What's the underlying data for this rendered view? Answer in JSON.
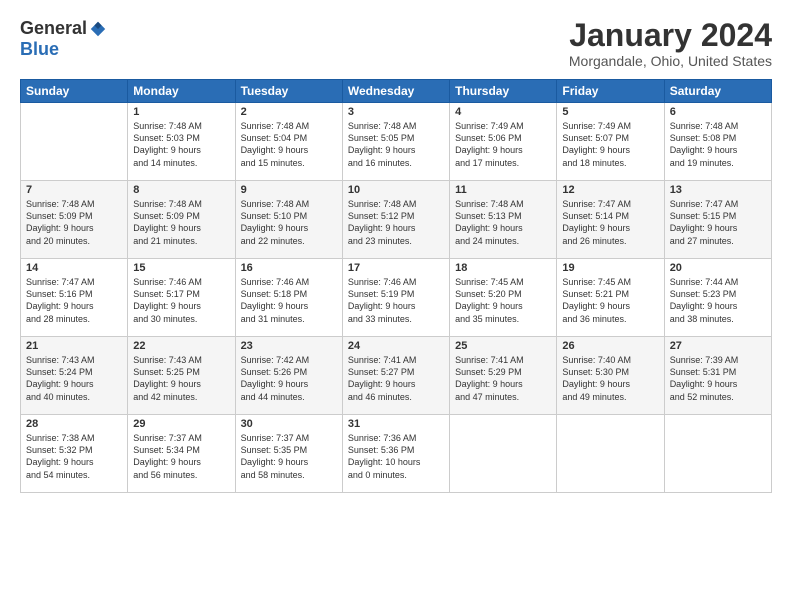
{
  "header": {
    "logo_general": "General",
    "logo_blue": "Blue",
    "title": "January 2024",
    "location": "Morgandale, Ohio, United States"
  },
  "days_of_week": [
    "Sunday",
    "Monday",
    "Tuesday",
    "Wednesday",
    "Thursday",
    "Friday",
    "Saturday"
  ],
  "weeks": [
    [
      {
        "day": "",
        "content": ""
      },
      {
        "day": "1",
        "content": "Sunrise: 7:48 AM\nSunset: 5:03 PM\nDaylight: 9 hours\nand 14 minutes."
      },
      {
        "day": "2",
        "content": "Sunrise: 7:48 AM\nSunset: 5:04 PM\nDaylight: 9 hours\nand 15 minutes."
      },
      {
        "day": "3",
        "content": "Sunrise: 7:48 AM\nSunset: 5:05 PM\nDaylight: 9 hours\nand 16 minutes."
      },
      {
        "day": "4",
        "content": "Sunrise: 7:49 AM\nSunset: 5:06 PM\nDaylight: 9 hours\nand 17 minutes."
      },
      {
        "day": "5",
        "content": "Sunrise: 7:49 AM\nSunset: 5:07 PM\nDaylight: 9 hours\nand 18 minutes."
      },
      {
        "day": "6",
        "content": "Sunrise: 7:48 AM\nSunset: 5:08 PM\nDaylight: 9 hours\nand 19 minutes."
      }
    ],
    [
      {
        "day": "7",
        "content": "Sunrise: 7:48 AM\nSunset: 5:09 PM\nDaylight: 9 hours\nand 20 minutes."
      },
      {
        "day": "8",
        "content": "Sunrise: 7:48 AM\nSunset: 5:09 PM\nDaylight: 9 hours\nand 21 minutes."
      },
      {
        "day": "9",
        "content": "Sunrise: 7:48 AM\nSunset: 5:10 PM\nDaylight: 9 hours\nand 22 minutes."
      },
      {
        "day": "10",
        "content": "Sunrise: 7:48 AM\nSunset: 5:12 PM\nDaylight: 9 hours\nand 23 minutes."
      },
      {
        "day": "11",
        "content": "Sunrise: 7:48 AM\nSunset: 5:13 PM\nDaylight: 9 hours\nand 24 minutes."
      },
      {
        "day": "12",
        "content": "Sunrise: 7:47 AM\nSunset: 5:14 PM\nDaylight: 9 hours\nand 26 minutes."
      },
      {
        "day": "13",
        "content": "Sunrise: 7:47 AM\nSunset: 5:15 PM\nDaylight: 9 hours\nand 27 minutes."
      }
    ],
    [
      {
        "day": "14",
        "content": "Sunrise: 7:47 AM\nSunset: 5:16 PM\nDaylight: 9 hours\nand 28 minutes."
      },
      {
        "day": "15",
        "content": "Sunrise: 7:46 AM\nSunset: 5:17 PM\nDaylight: 9 hours\nand 30 minutes."
      },
      {
        "day": "16",
        "content": "Sunrise: 7:46 AM\nSunset: 5:18 PM\nDaylight: 9 hours\nand 31 minutes."
      },
      {
        "day": "17",
        "content": "Sunrise: 7:46 AM\nSunset: 5:19 PM\nDaylight: 9 hours\nand 33 minutes."
      },
      {
        "day": "18",
        "content": "Sunrise: 7:45 AM\nSunset: 5:20 PM\nDaylight: 9 hours\nand 35 minutes."
      },
      {
        "day": "19",
        "content": "Sunrise: 7:45 AM\nSunset: 5:21 PM\nDaylight: 9 hours\nand 36 minutes."
      },
      {
        "day": "20",
        "content": "Sunrise: 7:44 AM\nSunset: 5:23 PM\nDaylight: 9 hours\nand 38 minutes."
      }
    ],
    [
      {
        "day": "21",
        "content": "Sunrise: 7:43 AM\nSunset: 5:24 PM\nDaylight: 9 hours\nand 40 minutes."
      },
      {
        "day": "22",
        "content": "Sunrise: 7:43 AM\nSunset: 5:25 PM\nDaylight: 9 hours\nand 42 minutes."
      },
      {
        "day": "23",
        "content": "Sunrise: 7:42 AM\nSunset: 5:26 PM\nDaylight: 9 hours\nand 44 minutes."
      },
      {
        "day": "24",
        "content": "Sunrise: 7:41 AM\nSunset: 5:27 PM\nDaylight: 9 hours\nand 46 minutes."
      },
      {
        "day": "25",
        "content": "Sunrise: 7:41 AM\nSunset: 5:29 PM\nDaylight: 9 hours\nand 47 minutes."
      },
      {
        "day": "26",
        "content": "Sunrise: 7:40 AM\nSunset: 5:30 PM\nDaylight: 9 hours\nand 49 minutes."
      },
      {
        "day": "27",
        "content": "Sunrise: 7:39 AM\nSunset: 5:31 PM\nDaylight: 9 hours\nand 52 minutes."
      }
    ],
    [
      {
        "day": "28",
        "content": "Sunrise: 7:38 AM\nSunset: 5:32 PM\nDaylight: 9 hours\nand 54 minutes."
      },
      {
        "day": "29",
        "content": "Sunrise: 7:37 AM\nSunset: 5:34 PM\nDaylight: 9 hours\nand 56 minutes."
      },
      {
        "day": "30",
        "content": "Sunrise: 7:37 AM\nSunset: 5:35 PM\nDaylight: 9 hours\nand 58 minutes."
      },
      {
        "day": "31",
        "content": "Sunrise: 7:36 AM\nSunset: 5:36 PM\nDaylight: 10 hours\nand 0 minutes."
      },
      {
        "day": "",
        "content": ""
      },
      {
        "day": "",
        "content": ""
      },
      {
        "day": "",
        "content": ""
      }
    ]
  ]
}
